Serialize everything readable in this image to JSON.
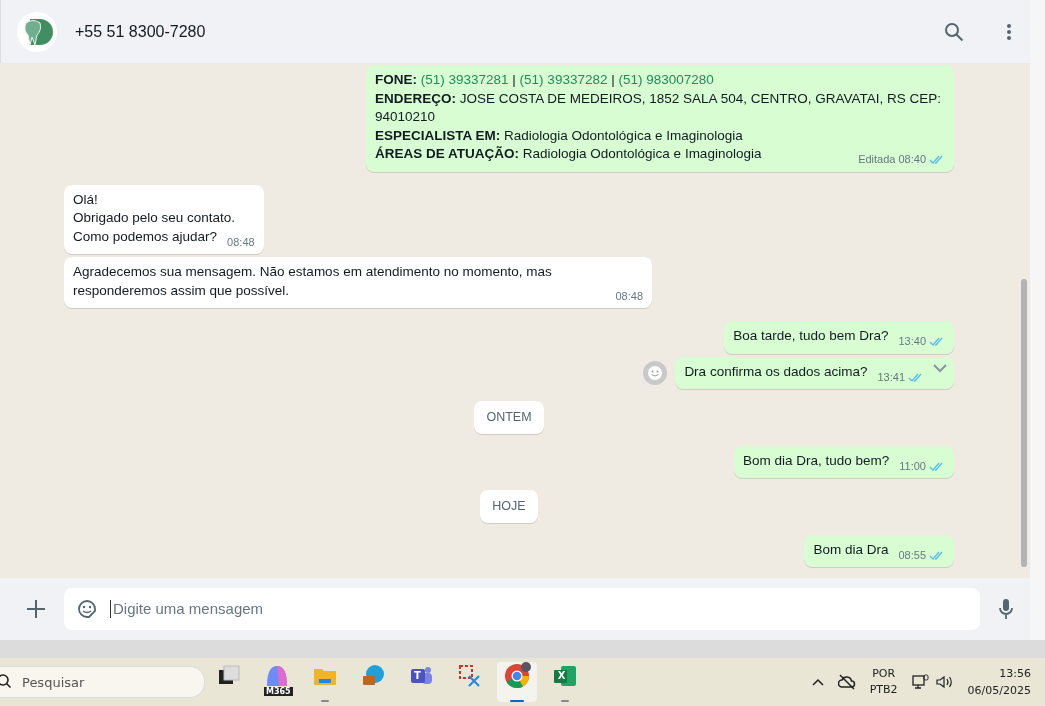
{
  "header": {
    "contact": "+55 51 8300-7280"
  },
  "messages": [
    {
      "kind": "out",
      "fields": [
        {
          "label": "FONE:",
          "links": [
            "(51) 39337281",
            "(51) 39337282",
            "(51) 983007280"
          ],
          "separator": "|"
        },
        {
          "label": "ENDEREÇO:",
          "text": "JOSE COSTA DE MEDEIROS, 1852 SALA 504, CENTRO, GRAVATAI, RS CEP: 94010210"
        },
        {
          "label": "ESPECIALISTA EM:",
          "text": "Radiologia Odontológica e Imaginologia"
        },
        {
          "label": "ÁREAS DE ATUAÇÃO:",
          "text": "Radiologia Odontológica e Imaginologia"
        }
      ],
      "edited": "Editada",
      "time": "08:40",
      "read": true,
      "hovered": false
    },
    {
      "kind": "in",
      "lines": [
        "Olá!",
        "Obrigado pelo seu contato.",
        "Como podemos ajudar?"
      ],
      "time": "08:48"
    },
    {
      "kind": "in",
      "lines": [
        "Agradecemos sua mensagem. Não estamos em atendimento no momento, mas responderemos assim que possível."
      ],
      "time": "08:48"
    },
    {
      "kind": "out",
      "lines": [
        "Boa tarde, tudo bem Dra?"
      ],
      "time": "13:40",
      "read": true,
      "hovered": false
    },
    {
      "kind": "out",
      "lines": [
        "Dra confirma os dados acima?"
      ],
      "time": "13:41",
      "read": true,
      "hovered": true
    },
    {
      "kind": "date",
      "text": "ONTEM"
    },
    {
      "kind": "out",
      "lines": [
        "Bom dia Dra, tudo bem?"
      ],
      "time": "11:00",
      "read": true,
      "hovered": false
    },
    {
      "kind": "date",
      "text": "HOJE"
    },
    {
      "kind": "out",
      "lines": [
        "Bom dia Dra"
      ],
      "time": "08:55",
      "read": true,
      "hovered": false
    }
  ],
  "composer": {
    "placeholder": "Digite uma mensagem"
  },
  "taskbar": {
    "search_placeholder": "Pesquisar",
    "apps": [
      {
        "kind": "taskview",
        "running": false,
        "selected": false
      },
      {
        "kind": "copilot",
        "badge": "M365",
        "running": false,
        "selected": false
      },
      {
        "kind": "folder",
        "running": true,
        "selected": false
      },
      {
        "kind": "edge",
        "running": false,
        "selected": false
      },
      {
        "kind": "teams",
        "letter": "T",
        "running": false,
        "selected": false
      },
      {
        "kind": "snip",
        "running": false,
        "selected": false
      },
      {
        "kind": "chrome",
        "running": true,
        "selected": true
      },
      {
        "kind": "excel",
        "letter": "X",
        "running": true,
        "selected": false
      }
    ]
  },
  "tray": {
    "language": "POR",
    "layout": "PTB2",
    "time": "13:56",
    "date": "06/05/2025"
  }
}
